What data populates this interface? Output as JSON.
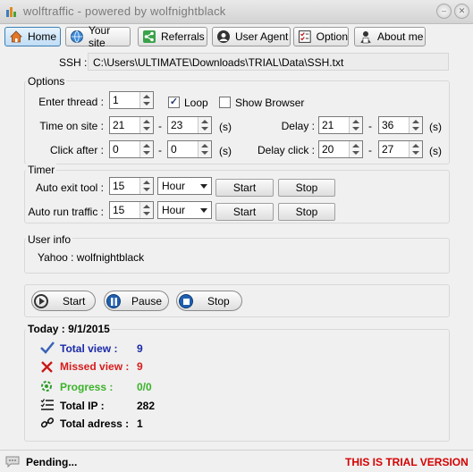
{
  "window": {
    "title": "wolftraffic - powered by wolfnightblack"
  },
  "tabs": [
    {
      "label": "Home",
      "icon": "home-icon",
      "active": true
    },
    {
      "label": "Your site",
      "icon": "globe-icon"
    },
    {
      "label": "Referrals",
      "icon": "share-icon"
    },
    {
      "label": "User Agent",
      "icon": "user-agent-icon"
    },
    {
      "label": "Option",
      "icon": "option-icon"
    },
    {
      "label": "About me",
      "icon": "person-icon"
    }
  ],
  "ssh": {
    "label": "SSH :",
    "path": "C:\\Users\\ULTIMATE\\Downloads\\TRIAL\\Data\\SSH.txt"
  },
  "options": {
    "title": "Options",
    "enter_thread_label": "Enter thread :",
    "enter_thread": "1",
    "loop_label": "Loop",
    "loop_checked": true,
    "show_browser_label": "Show Browser",
    "show_browser_checked": false,
    "time_on_site_label": "Time on site :",
    "time_on_site_min": "21",
    "time_on_site_max": "23",
    "unit": "(s)",
    "dash": "-",
    "delay_label": "Delay :",
    "delay_min": "21",
    "delay_max": "36",
    "click_after_label": "Click after :",
    "click_after_min": "0",
    "click_after_max": "0",
    "delay_click_label": "Delay click :",
    "delay_click_min": "20",
    "delay_click_max": "27"
  },
  "timer": {
    "title": "Timer",
    "auto_exit_label": "Auto exit tool :",
    "auto_exit_value": "15",
    "auto_exit_unit": "Hour",
    "auto_run_label": "Auto run traffic :",
    "auto_run_value": "15",
    "auto_run_unit": "Hour",
    "start_label": "Start",
    "stop_label": "Stop"
  },
  "user_info": {
    "title": "User info",
    "text": "Yahoo : wolfnightblack"
  },
  "controls": {
    "start": "Start",
    "pause": "Pause",
    "stop": "Stop"
  },
  "stats": {
    "title": "Today : 9/1/2015",
    "total_view_label": "Total view :",
    "total_view": "9",
    "missed_view_label": "Missed view :",
    "missed_view": "9",
    "progress_label": "Progress :",
    "progress": "0/0",
    "total_ip_label": "Total IP :",
    "total_ip": "282",
    "total_adress_label": "Total adress :",
    "total_adress": "1"
  },
  "status": {
    "text": "Pending...",
    "trial": "THIS IS TRIAL VERSION"
  },
  "colors": {
    "blue": "#1a2aa8",
    "red": "#d81b1b",
    "green": "#3cb32a",
    "trial_red": "#d40000"
  }
}
